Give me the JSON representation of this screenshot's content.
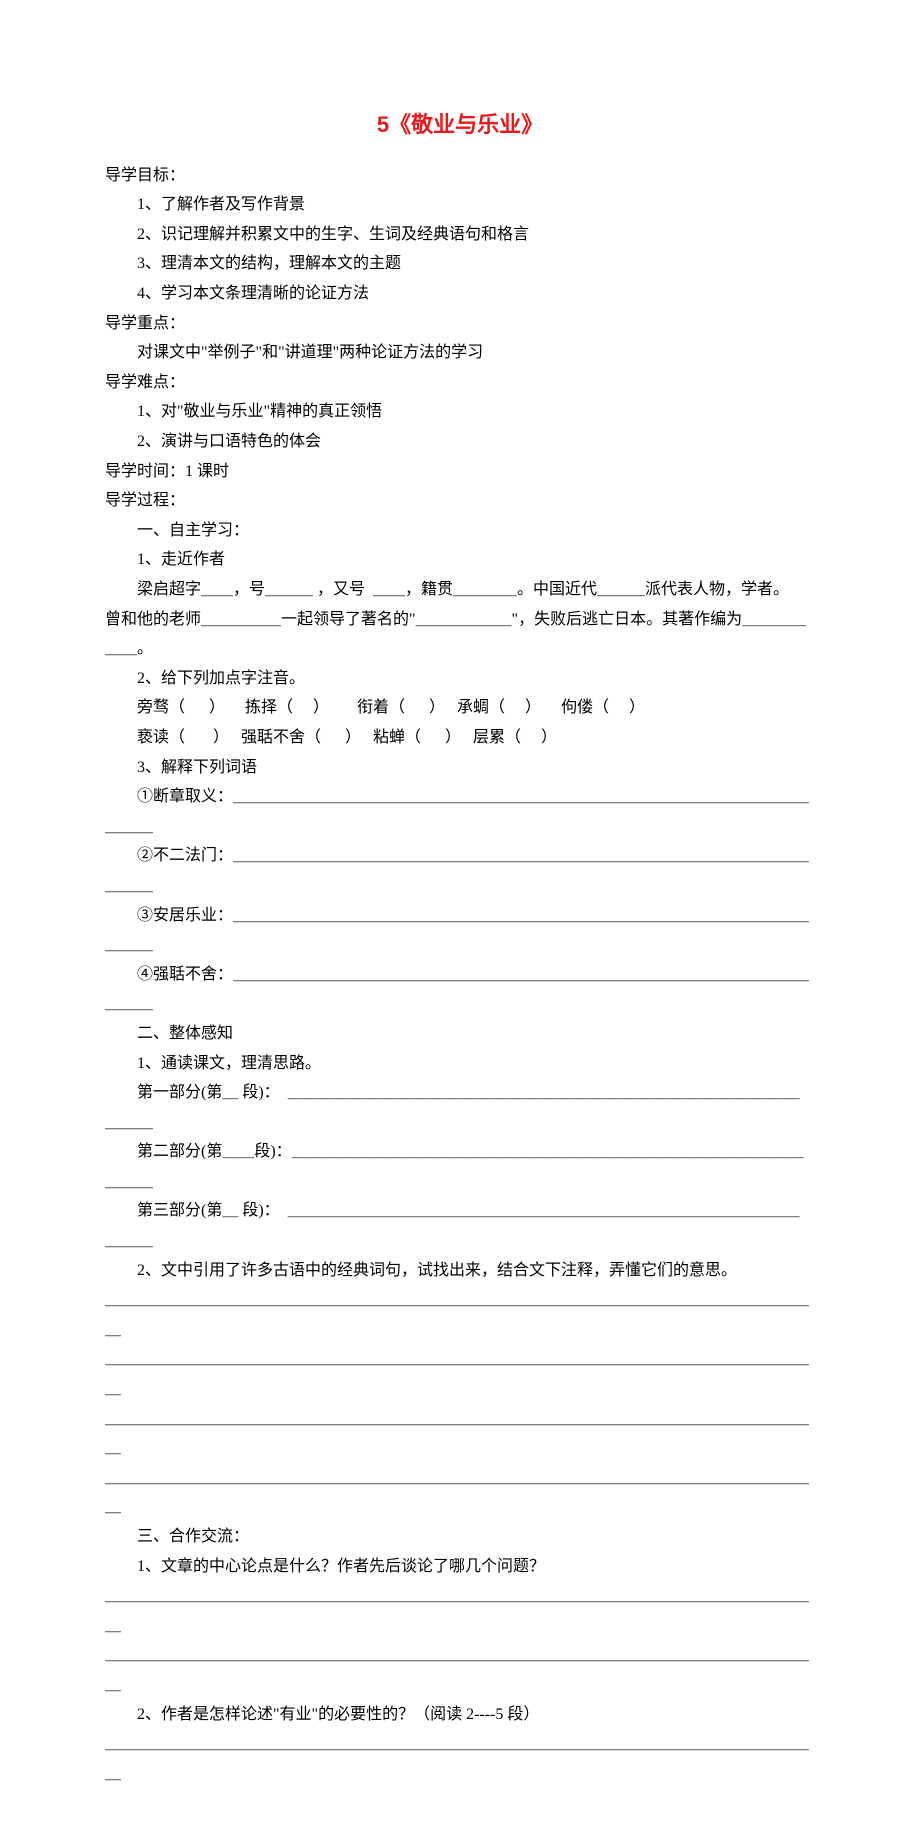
{
  "title": "5《敬业与乐业》",
  "section_goal_label": "导学目标：",
  "goals": [
    "1、了解作者及写作背景",
    "2、识记理解并积累文中的生字、生词及经典语句和格言",
    "3、理清本文的结构，理解本文的主题",
    "4、学习本文条理清晰的论证方法"
  ],
  "section_focus_label": "导学重点：",
  "focus_text": "对课文中\"举例子\"和\"讲道理\"两种论证方法的学习",
  "section_difficulty_label": "导学难点：",
  "difficulties": [
    "1、对\"敬业与乐业\"精神的真正领悟",
    "2、演讲与口语特色的体会"
  ],
  "time_label": "导学时间：1 课时",
  "process_label": "导学过程：",
  "self_study_label": "一、自主学习：",
  "author_label": "1、走近作者",
  "author_line1": "梁启超字＿＿，号＿＿＿ ，又号  ＿＿，籍贯＿＿＿＿。中国近代＿＿＿派代表人物，学者。",
  "author_line2": "曾和他的老师＿＿＿＿＿一起领导了著名的\"＿＿＿＿＿＿\"，失败后逃亡日本。其著作编为＿＿＿＿＿＿。",
  "pinyin_label": "2、给下列加点字注音。",
  "pinyin_line1": "旁骛（      ）     拣择（     ）       衔着（      ）   承蜩（     ）     佝偻（     ）",
  "pinyin_line2": "亵读（       ）   强聒不舍（      ）   粘蝉（      ）   层累（     ）",
  "words_label": "3、解释下列词语",
  "word1": "①断章取义：＿＿＿＿＿＿＿＿＿＿＿＿＿＿＿＿＿＿＿＿＿＿＿＿＿＿＿＿＿＿＿＿＿＿＿＿＿＿＿",
  "word2": "②不二法门：＿＿＿＿＿＿＿＿＿＿＿＿＿＿＿＿＿＿＿＿＿＿＿＿＿＿＿＿＿＿＿＿＿＿＿＿＿＿＿",
  "word3": "③安居乐业：＿＿＿＿＿＿＿＿＿＿＿＿＿＿＿＿＿＿＿＿＿＿＿＿＿＿＿＿＿＿＿＿＿＿＿＿＿＿＿",
  "word4": "④强聒不舍：＿＿＿＿＿＿＿＿＿＿＿＿＿＿＿＿＿＿＿＿＿＿＿＿＿＿＿＿＿＿＿＿＿＿＿＿＿＿＿",
  "overall_label": "二、整体感知",
  "overall1": "1、通读课文，理清思路。",
  "part1": "第一部分(第＿ 段)：  ＿＿＿＿＿＿＿＿＿＿＿＿＿＿＿＿＿＿＿＿＿＿＿＿＿＿＿＿＿＿＿＿＿＿＿",
  "part2": "第二部分(第＿＿段)：＿＿＿＿＿＿＿＿＿＿＿＿＿＿＿＿＿＿＿＿＿＿＿＿＿＿＿＿＿＿＿＿＿＿＿",
  "part3": "第三部分(第＿ 段)：  ＿＿＿＿＿＿＿＿＿＿＿＿＿＿＿＿＿＿＿＿＿＿＿＿＿＿＿＿＿＿＿＿＿＿＿",
  "overall2": "2、文中引用了许多古语中的经典词句，试找出来，结合文下注释，弄懂它们的意思。",
  "blank_line": "＿＿＿＿＿＿＿＿＿＿＿＿＿＿＿＿＿＿＿＿＿＿＿＿＿＿＿＿＿＿＿＿＿＿＿＿＿＿＿＿＿＿＿＿＿",
  "coop_label": "三、合作交流：",
  "coop_q1": "1、文章的中心论点是什么？作者先后谈论了哪几个问题？",
  "coop_q2": "2、作者是怎样论述\"有业\"的必要性的？（阅读 2----5 段）"
}
